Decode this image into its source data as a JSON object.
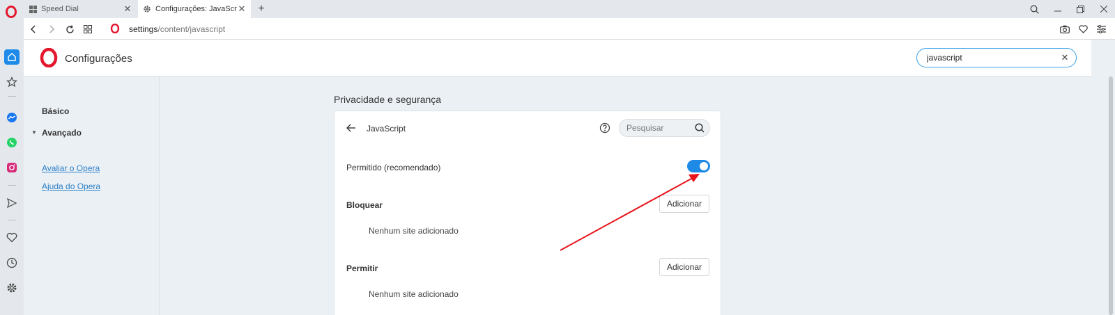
{
  "tabs": [
    {
      "title": "Speed Dial",
      "icon": "speed-dial-icon",
      "active": false
    },
    {
      "title": "Configurações: JavaScript",
      "icon": "gear-icon",
      "active": true
    }
  ],
  "address": {
    "host": "settings",
    "path": "/content/javascript"
  },
  "settings": {
    "title": "Configurações",
    "search_value": "javascript"
  },
  "nav": {
    "basic": "Básico",
    "advanced": "Avançado",
    "rate": "Avaliar o Opera",
    "help": "Ajuda do Opera"
  },
  "content": {
    "section_title": "Privacidade e segurança",
    "page_title": "JavaScript",
    "search_placeholder": "Pesquisar",
    "allowed_label": "Permitido (recomendado)",
    "allowed_on": true,
    "block_title": "Bloquear",
    "block_add": "Adicionar",
    "block_empty": "Nenhum site adicionado",
    "allow_title": "Permitir",
    "allow_add": "Adicionar",
    "allow_empty": "Nenhum site adicionado"
  },
  "colors": {
    "accent": "#1e8ae8",
    "opera_red": "#e3172e",
    "annotation_arrow": "#e8131b"
  }
}
